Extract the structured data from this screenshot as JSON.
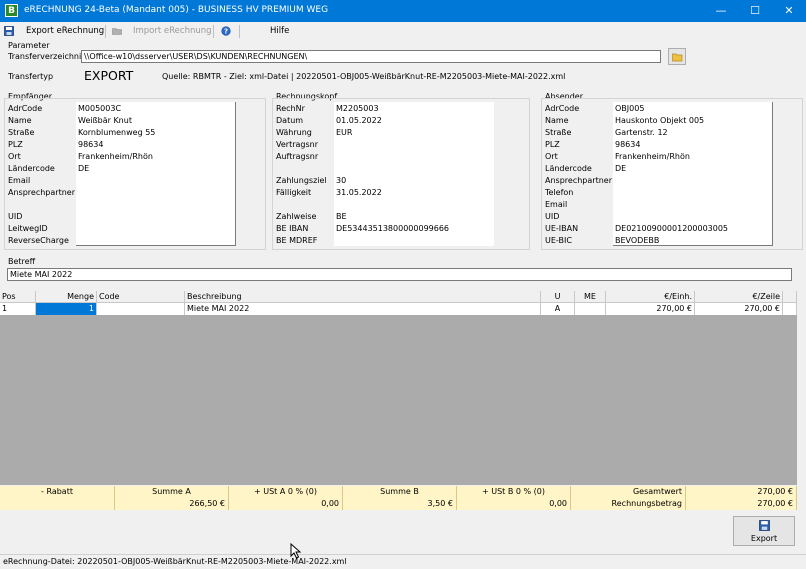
{
  "window": {
    "title": "eRECHNUNG 24-Beta (Mandant 005) - BUSINESS HV PREMIUM WEG",
    "app_icon_letter": "B",
    "minimize": "—",
    "maximize": "☐",
    "close": "✕"
  },
  "toolbar": {
    "export_label": "Export eRechnung",
    "import_label": "Import eRechnung",
    "help_label": "Hilfe"
  },
  "parameter": {
    "group_label": "Parameter",
    "transfer_dir_label": "Transferverzeichnis",
    "transfer_dir_value": "\\\\Office-w10\\dsserver\\USER\\DS\\KUNDEN\\RECHNUNGEN\\",
    "transfer_type_label": "Transfertyp",
    "transfer_type_value": "EXPORT",
    "source_text": "Quelle: RBMTR - Ziel: xml-Datei | 20220501-OBJ005-WeißbärKnut-RE-M2205003-Miete-MAI-2022.xml"
  },
  "recipient": {
    "group_label": "Empfänger",
    "rows": [
      {
        "label": "AdrCode",
        "value": "M005003C"
      },
      {
        "label": "Name",
        "value": "Weißbär Knut"
      },
      {
        "label": "Straße",
        "value": "Kornblumenweg 55"
      },
      {
        "label": "PLZ",
        "value": "98634"
      },
      {
        "label": "Ort",
        "value": "Frankenheim/Rhön"
      },
      {
        "label": "Ländercode",
        "value": "DE"
      },
      {
        "label": "Email",
        "value": ""
      },
      {
        "label": "Ansprechpartner",
        "value": ""
      },
      {
        "label": "",
        "value": ""
      },
      {
        "label": "UID",
        "value": ""
      },
      {
        "label": "LeitwegID",
        "value": ""
      },
      {
        "label": "ReverseCharge",
        "value": ""
      }
    ]
  },
  "invoice_head": {
    "group_label": "Rechnungskopf",
    "rows": [
      {
        "label": "RechNr",
        "value": "M2205003"
      },
      {
        "label": "Datum",
        "value": "01.05.2022"
      },
      {
        "label": "Währung",
        "value": "EUR"
      },
      {
        "label": "Vertragsnr",
        "value": ""
      },
      {
        "label": "Auftragsnr",
        "value": ""
      },
      {
        "label": "",
        "value": ""
      },
      {
        "label": "Zahlungsziel",
        "value": "30"
      },
      {
        "label": "Fälligkeit",
        "value": "31.05.2022"
      },
      {
        "label": "",
        "value": ""
      },
      {
        "label": "Zahlweise",
        "value": "BE"
      },
      {
        "label": "BE IBAN",
        "value": "DE53443513800000099666"
      },
      {
        "label": "BE MDREF",
        "value": ""
      }
    ]
  },
  "sender": {
    "group_label": "Absender",
    "rows": [
      {
        "label": "AdrCode",
        "value": "OBJ005"
      },
      {
        "label": "Name",
        "value": "Hauskonto Objekt 005"
      },
      {
        "label": "Straße",
        "value": "Gartenstr. 12"
      },
      {
        "label": "PLZ",
        "value": "98634"
      },
      {
        "label": "Ort",
        "value": "Frankenheim/Rhön"
      },
      {
        "label": "Ländercode",
        "value": "DE"
      },
      {
        "label": "Ansprechpartner",
        "value": ""
      },
      {
        "label": "Telefon",
        "value": ""
      },
      {
        "label": "Email",
        "value": ""
      },
      {
        "label": "UID",
        "value": ""
      },
      {
        "label": "UE-IBAN",
        "value": "DE02100900001200003005"
      },
      {
        "label": "UE-BIC",
        "value": "BEVODEBB"
      }
    ]
  },
  "subject": {
    "label": "Betreff",
    "value": "Miete MAI 2022"
  },
  "table": {
    "headers": {
      "pos": "Pos",
      "menge": "Menge",
      "code": "Code",
      "beschreibung": "Beschreibung",
      "u": "U",
      "me": "ME",
      "einh": "€/Einh.",
      "zeile": "€/Zeile"
    },
    "rows": [
      {
        "pos": "1",
        "menge": "1",
        "code": "",
        "beschreibung": "Miete MAI 2022",
        "u": "A",
        "me": "",
        "einh": "270,00 €",
        "zeile": "270,00 €"
      }
    ]
  },
  "totals": {
    "rabatt_label": "- Rabatt",
    "summe_a_label": "Summe A",
    "ust_a_label": "+ USt A 0 % (0)",
    "summe_b_label": "Summe B",
    "ust_b_label": "+ USt B 0 % (0)",
    "gesamtwert_label": "Gesamtwert",
    "gesamtwert_value": "270,00 €",
    "rabatt_value": "",
    "summe_a_value": "266,50 €",
    "ust_a_value": "0,00",
    "summe_b_value": "3,50 €",
    "ust_b_value": "0,00",
    "rechnungsbetrag_label": "Rechnungsbetrag",
    "rechnungsbetrag_value": "270,00 €"
  },
  "export_button": {
    "label": "Export"
  },
  "status_bar": {
    "text": "eRechnung-Datei: 20220501-OBJ005-WeißbärKnut-RE-M2205003-Miete-MAI-2022.xml"
  },
  "colors": {
    "titlebar": "#0078d7",
    "selection": "#0078d7",
    "totals_background": "#fff5c6",
    "grid_empty": "#ababab"
  },
  "icons": {
    "save": "floppy-disk-icon",
    "import": "folder-icon",
    "help": "help-icon",
    "browse": "folder-open-icon",
    "export": "floppy-disk-icon"
  }
}
